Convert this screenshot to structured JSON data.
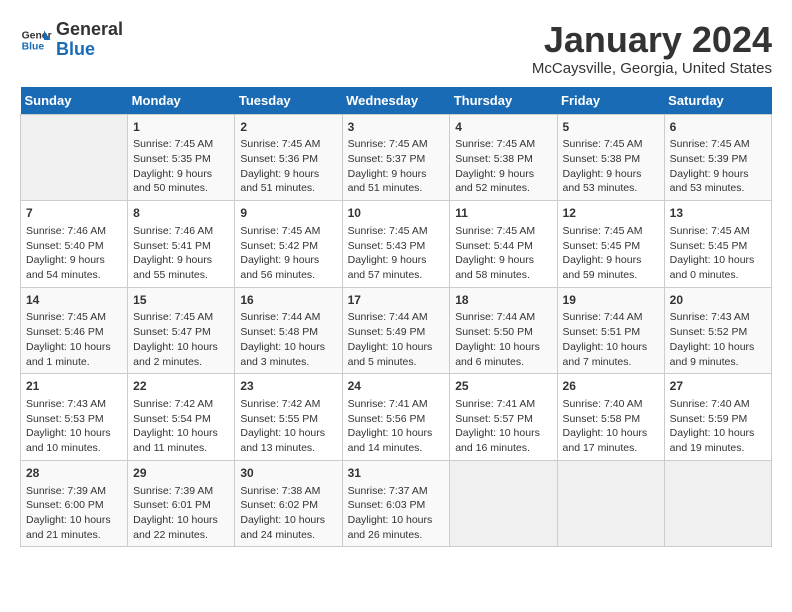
{
  "header": {
    "logo_line1": "General",
    "logo_line2": "Blue",
    "title": "January 2024",
    "subtitle": "McCaysville, Georgia, United States"
  },
  "days_of_week": [
    "Sunday",
    "Monday",
    "Tuesday",
    "Wednesday",
    "Thursday",
    "Friday",
    "Saturday"
  ],
  "weeks": [
    [
      {
        "day": "",
        "info": ""
      },
      {
        "day": "1",
        "info": "Sunrise: 7:45 AM\nSunset: 5:35 PM\nDaylight: 9 hours\nand 50 minutes."
      },
      {
        "day": "2",
        "info": "Sunrise: 7:45 AM\nSunset: 5:36 PM\nDaylight: 9 hours\nand 51 minutes."
      },
      {
        "day": "3",
        "info": "Sunrise: 7:45 AM\nSunset: 5:37 PM\nDaylight: 9 hours\nand 51 minutes."
      },
      {
        "day": "4",
        "info": "Sunrise: 7:45 AM\nSunset: 5:38 PM\nDaylight: 9 hours\nand 52 minutes."
      },
      {
        "day": "5",
        "info": "Sunrise: 7:45 AM\nSunset: 5:38 PM\nDaylight: 9 hours\nand 53 minutes."
      },
      {
        "day": "6",
        "info": "Sunrise: 7:45 AM\nSunset: 5:39 PM\nDaylight: 9 hours\nand 53 minutes."
      }
    ],
    [
      {
        "day": "7",
        "info": "Sunrise: 7:46 AM\nSunset: 5:40 PM\nDaylight: 9 hours\nand 54 minutes."
      },
      {
        "day": "8",
        "info": "Sunrise: 7:46 AM\nSunset: 5:41 PM\nDaylight: 9 hours\nand 55 minutes."
      },
      {
        "day": "9",
        "info": "Sunrise: 7:45 AM\nSunset: 5:42 PM\nDaylight: 9 hours\nand 56 minutes."
      },
      {
        "day": "10",
        "info": "Sunrise: 7:45 AM\nSunset: 5:43 PM\nDaylight: 9 hours\nand 57 minutes."
      },
      {
        "day": "11",
        "info": "Sunrise: 7:45 AM\nSunset: 5:44 PM\nDaylight: 9 hours\nand 58 minutes."
      },
      {
        "day": "12",
        "info": "Sunrise: 7:45 AM\nSunset: 5:45 PM\nDaylight: 9 hours\nand 59 minutes."
      },
      {
        "day": "13",
        "info": "Sunrise: 7:45 AM\nSunset: 5:45 PM\nDaylight: 10 hours\nand 0 minutes."
      }
    ],
    [
      {
        "day": "14",
        "info": "Sunrise: 7:45 AM\nSunset: 5:46 PM\nDaylight: 10 hours\nand 1 minute."
      },
      {
        "day": "15",
        "info": "Sunrise: 7:45 AM\nSunset: 5:47 PM\nDaylight: 10 hours\nand 2 minutes."
      },
      {
        "day": "16",
        "info": "Sunrise: 7:44 AM\nSunset: 5:48 PM\nDaylight: 10 hours\nand 3 minutes."
      },
      {
        "day": "17",
        "info": "Sunrise: 7:44 AM\nSunset: 5:49 PM\nDaylight: 10 hours\nand 5 minutes."
      },
      {
        "day": "18",
        "info": "Sunrise: 7:44 AM\nSunset: 5:50 PM\nDaylight: 10 hours\nand 6 minutes."
      },
      {
        "day": "19",
        "info": "Sunrise: 7:44 AM\nSunset: 5:51 PM\nDaylight: 10 hours\nand 7 minutes."
      },
      {
        "day": "20",
        "info": "Sunrise: 7:43 AM\nSunset: 5:52 PM\nDaylight: 10 hours\nand 9 minutes."
      }
    ],
    [
      {
        "day": "21",
        "info": "Sunrise: 7:43 AM\nSunset: 5:53 PM\nDaylight: 10 hours\nand 10 minutes."
      },
      {
        "day": "22",
        "info": "Sunrise: 7:42 AM\nSunset: 5:54 PM\nDaylight: 10 hours\nand 11 minutes."
      },
      {
        "day": "23",
        "info": "Sunrise: 7:42 AM\nSunset: 5:55 PM\nDaylight: 10 hours\nand 13 minutes."
      },
      {
        "day": "24",
        "info": "Sunrise: 7:41 AM\nSunset: 5:56 PM\nDaylight: 10 hours\nand 14 minutes."
      },
      {
        "day": "25",
        "info": "Sunrise: 7:41 AM\nSunset: 5:57 PM\nDaylight: 10 hours\nand 16 minutes."
      },
      {
        "day": "26",
        "info": "Sunrise: 7:40 AM\nSunset: 5:58 PM\nDaylight: 10 hours\nand 17 minutes."
      },
      {
        "day": "27",
        "info": "Sunrise: 7:40 AM\nSunset: 5:59 PM\nDaylight: 10 hours\nand 19 minutes."
      }
    ],
    [
      {
        "day": "28",
        "info": "Sunrise: 7:39 AM\nSunset: 6:00 PM\nDaylight: 10 hours\nand 21 minutes."
      },
      {
        "day": "29",
        "info": "Sunrise: 7:39 AM\nSunset: 6:01 PM\nDaylight: 10 hours\nand 22 minutes."
      },
      {
        "day": "30",
        "info": "Sunrise: 7:38 AM\nSunset: 6:02 PM\nDaylight: 10 hours\nand 24 minutes."
      },
      {
        "day": "31",
        "info": "Sunrise: 7:37 AM\nSunset: 6:03 PM\nDaylight: 10 hours\nand 26 minutes."
      },
      {
        "day": "",
        "info": ""
      },
      {
        "day": "",
        "info": ""
      },
      {
        "day": "",
        "info": ""
      }
    ]
  ]
}
